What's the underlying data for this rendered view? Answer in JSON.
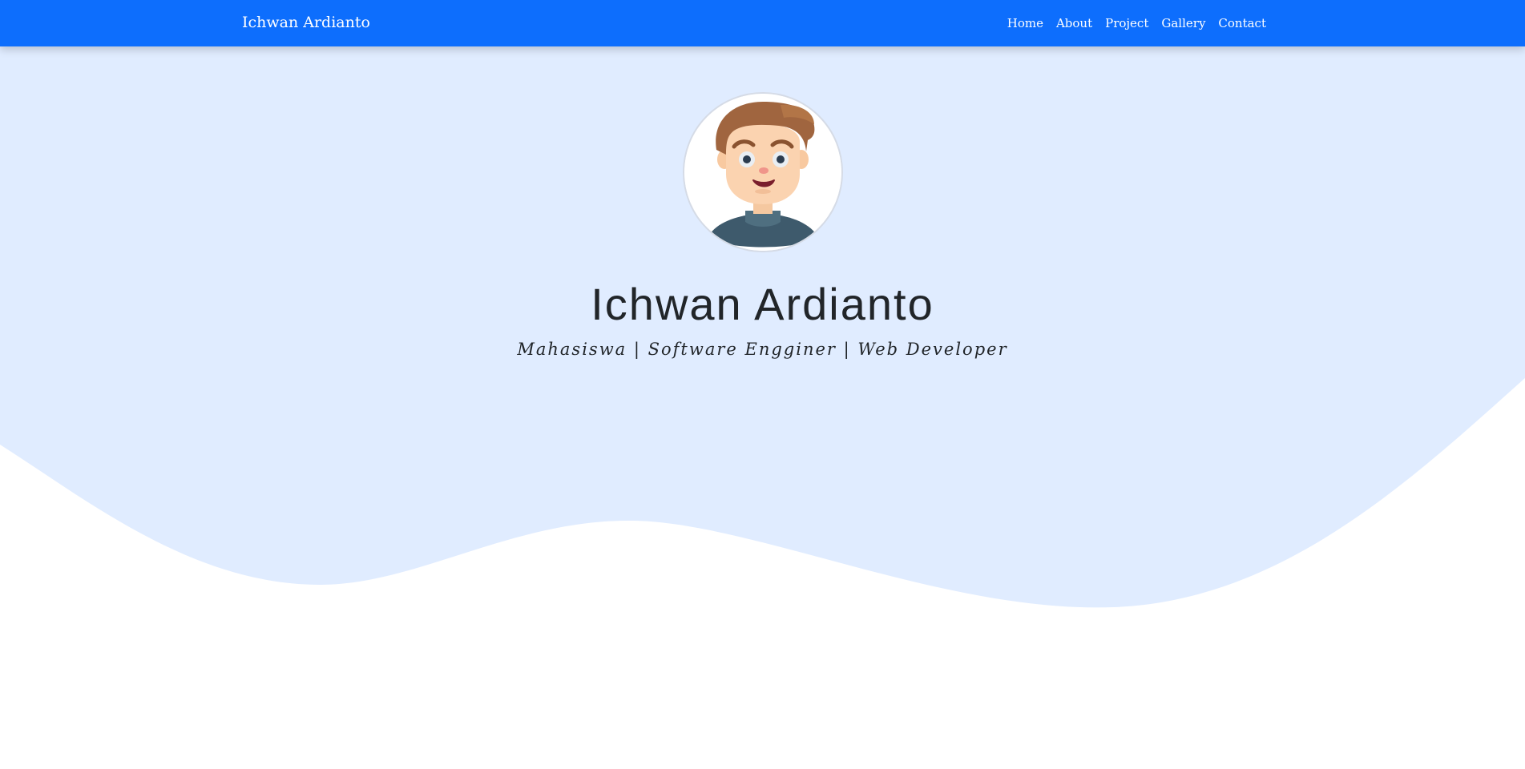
{
  "navbar": {
    "brand": "Ichwan Ardianto",
    "links": [
      {
        "label": "Home"
      },
      {
        "label": "About"
      },
      {
        "label": "Project"
      },
      {
        "label": "Gallery"
      },
      {
        "label": "Contact"
      }
    ]
  },
  "hero": {
    "name": "Ichwan Ardianto",
    "tagline": "Mahasiswa | Software Engginer | Web Developer",
    "avatar_icon": "cartoon-boy-avatar"
  },
  "colors": {
    "navbar_bg": "#0d6efd",
    "hero_bg": "#e0ecff",
    "text": "#212529"
  }
}
